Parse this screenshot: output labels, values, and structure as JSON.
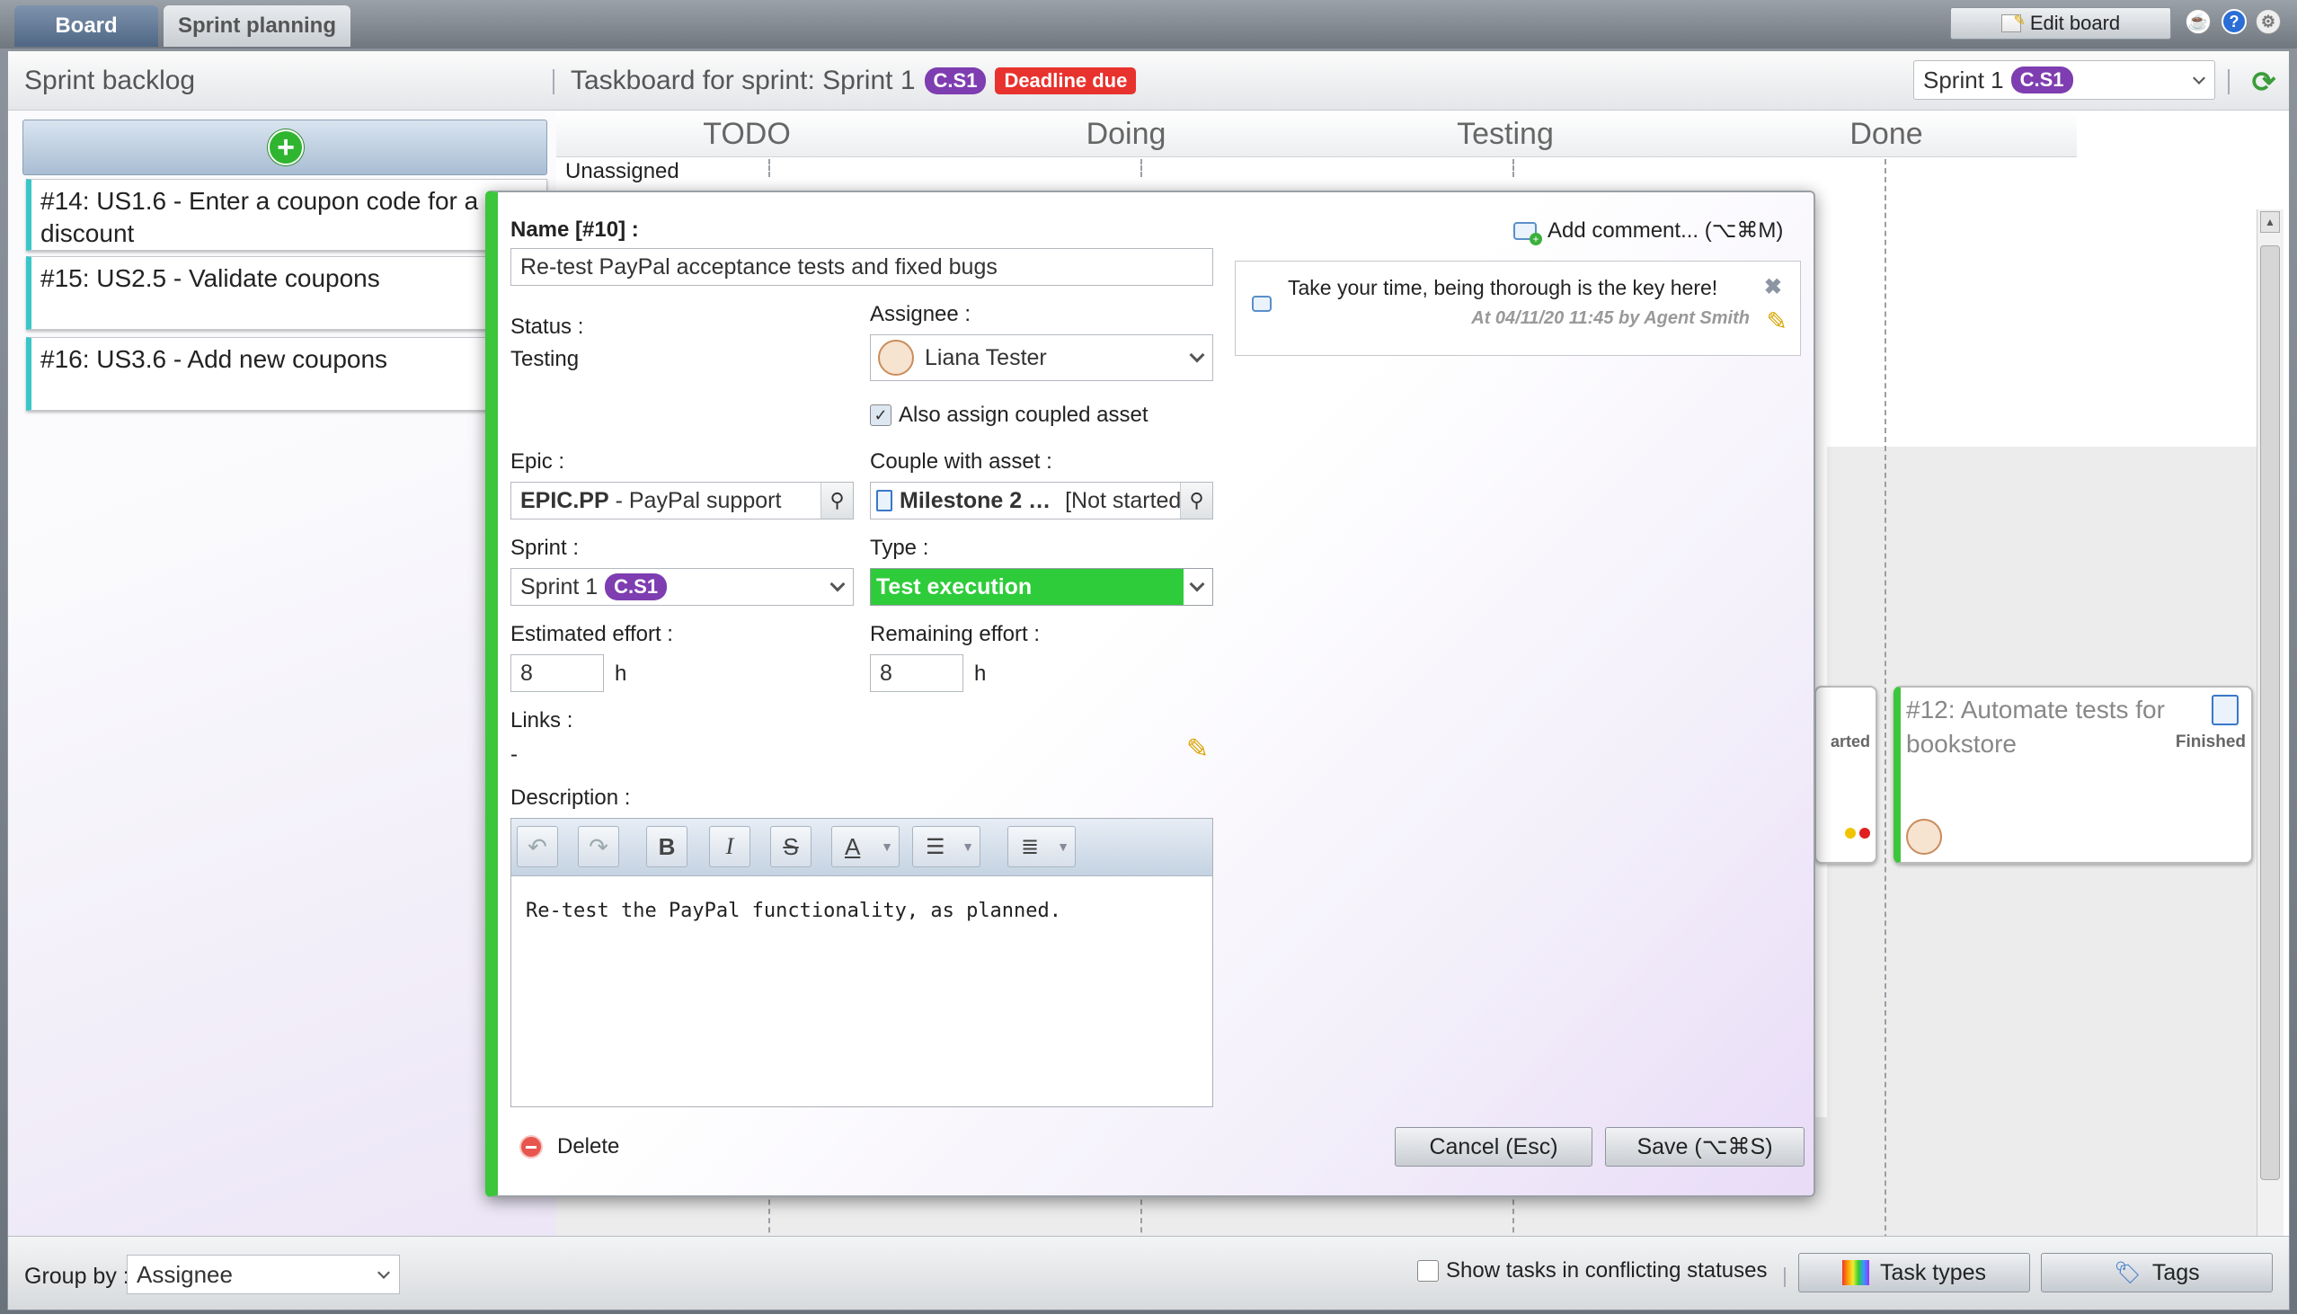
{
  "tabs": [
    {
      "label": "Board"
    },
    {
      "label": "Sprint planning"
    }
  ],
  "toolbar": {
    "edit_board": "Edit board"
  },
  "header": {
    "backlog_title": "Sprint backlog",
    "taskboard_title": "Taskboard for sprint: Sprint 1",
    "sprint_badge": "C.S1",
    "deadline_badge": "Deadline due",
    "sprint_select": "Sprint 1",
    "sprint_select_badge": "C.S1"
  },
  "backlog": {
    "items": [
      {
        "label": "#14: US1.6 - Enter a coupon code for a discount"
      },
      {
        "label": "#15: US2.5 - Validate coupons"
      },
      {
        "label": "#16: US3.6 - Add new coupons"
      }
    ]
  },
  "board": {
    "columns": [
      "TODO",
      "Doing",
      "Testing",
      "Done"
    ],
    "row_label": "Unassigned",
    "cards": [
      {
        "title": "#12: Automate tests for bookstore",
        "status": "Finished"
      },
      {
        "status_partial": "arted"
      }
    ]
  },
  "modal": {
    "name_label": "Name [#10] :",
    "name_value": "Re-test PayPal acceptance tests and fixed bugs",
    "status_label": "Status :",
    "status_value": "Testing",
    "assignee_label": "Assignee :",
    "assignee_value": "Liana Tester",
    "also_assign": "Also assign coupled asset",
    "epic_label": "Epic :",
    "epic_code": "EPIC.PP",
    "epic_name": " - PayPal support",
    "couple_label": "Couple with asset :",
    "couple_name": "Milestone 2 …",
    "couple_status": "[Not started]",
    "sprint_label": "Sprint :",
    "sprint_value": "Sprint 1",
    "sprint_badge": "C.S1",
    "type_label": "Type :",
    "type_value": "Test execution",
    "type_color": "#2ecc3a",
    "est_label": "Estimated effort :",
    "est_value": "8",
    "rem_label": "Remaining effort :",
    "rem_value": "8",
    "hour_unit": "h",
    "links_label": "Links :",
    "links_value": "-",
    "desc_label": "Description :",
    "desc_value": "Re-test the PayPal functionality, as planned.",
    "add_comment": "Add comment... (⌥⌘M)",
    "comment_text": "Take your time, being thorough is the key here!",
    "comment_meta": "At 04/11/20 11:45 by Agent Smith",
    "delete": "Delete",
    "cancel": "Cancel (Esc)",
    "save": "Save (⌥⌘S)"
  },
  "bottom": {
    "group_by_label": "Group by :",
    "group_by_value": "Assignee",
    "conflict_label": "Show tasks in conflicting statuses",
    "task_types": "Task types",
    "tags": "Tags"
  }
}
